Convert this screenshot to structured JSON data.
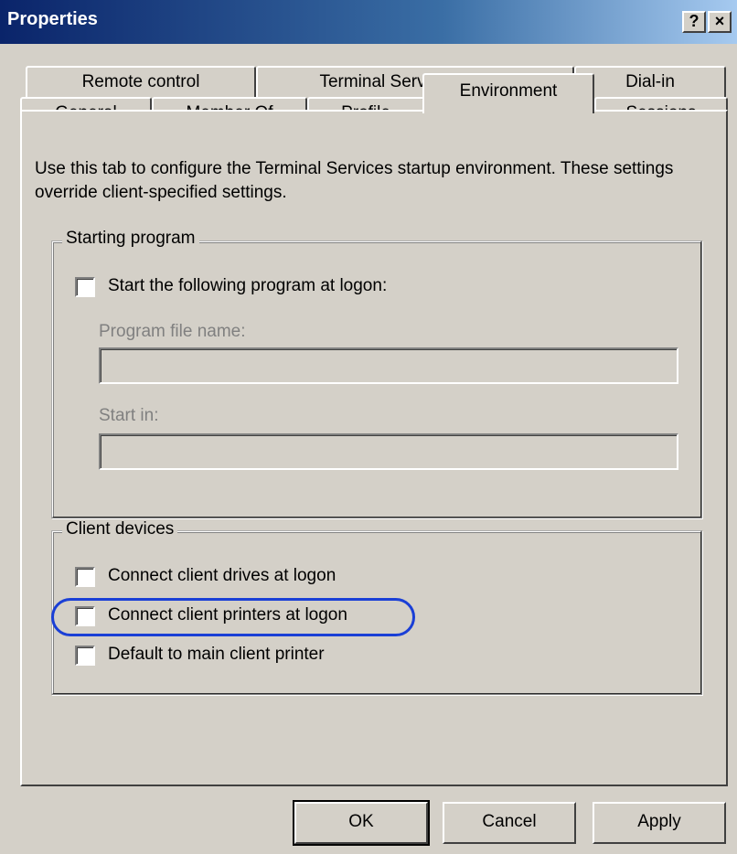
{
  "window": {
    "title": "Properties",
    "help_button": "?",
    "close_button": "×"
  },
  "tabs": {
    "row1": [
      "Remote control",
      "Terminal Services Profile",
      "Dial-in"
    ],
    "row2": [
      "General",
      "Member Of",
      "Profile",
      "Environment",
      "Sessions"
    ],
    "active": "Environment"
  },
  "environment": {
    "intro": "Use this tab to configure the Terminal Services startup environment. These settings override client-specified settings.",
    "starting_program": {
      "legend": "Starting program",
      "checkbox_label": "Start the following program at logon:",
      "checked": false,
      "program_label": "Program file name:",
      "program_value": "",
      "start_in_label": "Start in:",
      "start_in_value": ""
    },
    "client_devices": {
      "legend": "Client devices",
      "items": [
        {
          "label": "Connect client drives at logon",
          "checked": false
        },
        {
          "label": "Connect client printers at logon",
          "checked": false,
          "highlighted": true
        },
        {
          "label": "Default to main client printer",
          "checked": false
        }
      ]
    }
  },
  "buttons": {
    "ok": "OK",
    "cancel": "Cancel",
    "apply": "Apply"
  },
  "colors": {
    "titlebar_start": "#0a246a",
    "titlebar_end": "#a6caf0",
    "face": "#d4d0c8",
    "highlight_ring": "#1a3fd6"
  }
}
